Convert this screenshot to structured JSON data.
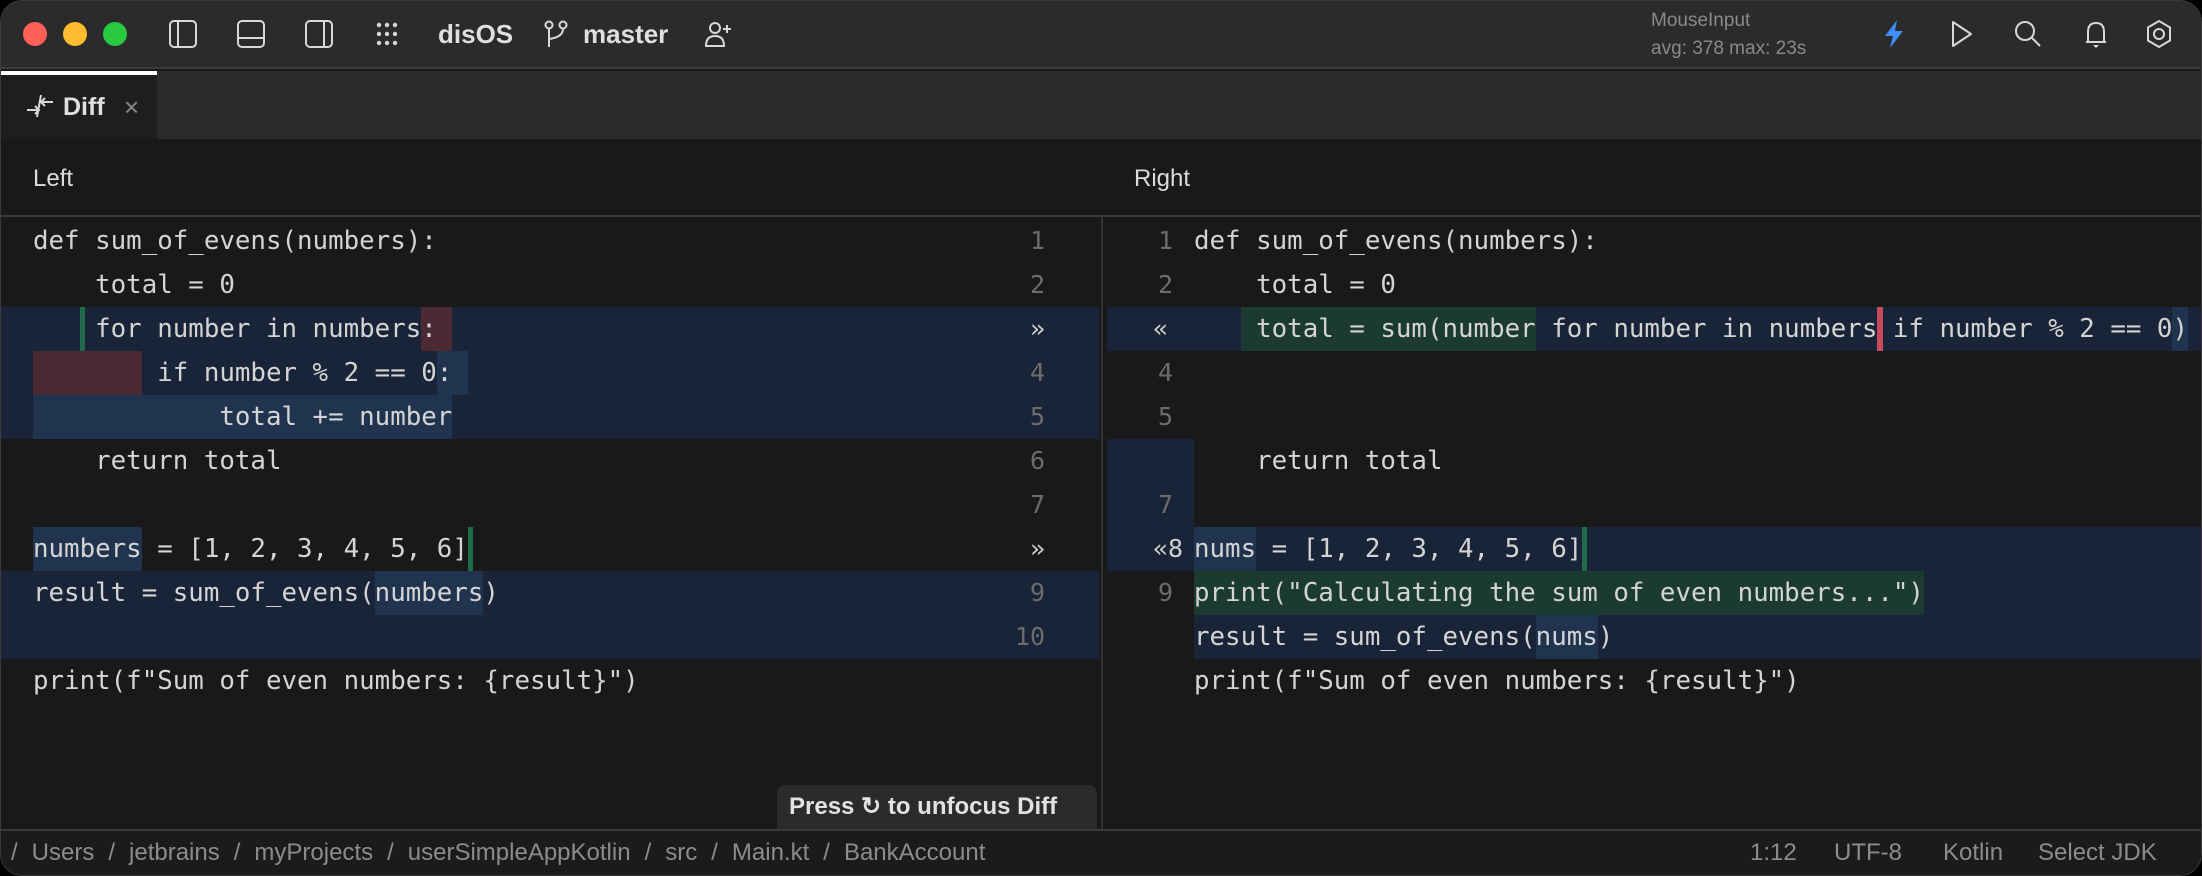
{
  "titlebar": {
    "project": "disOS",
    "branch": "master",
    "perf_title": "MouseInput",
    "perf_stats": "avg: 378 max: 23s",
    "icons": [
      "toggle-left-panel-icon",
      "toggle-bottom-panel-icon",
      "toggle-right-panel-icon",
      "apps-grid-icon",
      "branch-icon",
      "add-user-icon",
      "lightning-icon",
      "run-icon",
      "search-icon",
      "bell-icon",
      "settings-icon"
    ],
    "colors": {
      "accent": "#3d8ef8",
      "close": "#fe5f57",
      "minimize": "#febc2e",
      "maximize": "#28c840"
    }
  },
  "tab": {
    "label": "Diff",
    "close": "×"
  },
  "headers": {
    "left": "Left",
    "right": "Right"
  },
  "left": {
    "lines": [
      "def sum_of_evens(numbers):",
      "    total = 0",
      "    for number in numbers:",
      "        if number % 2 == 0:",
      "            total += number",
      "    return total",
      "",
      "numbers = [1, 2, 3, 4, 5, 6]",
      "result = sum_of_evens(numbers)",
      "",
      "print(f\"Sum of even numbers: {result}\")"
    ],
    "gutter": [
      "1",
      "2",
      "»",
      "4",
      "5",
      "6",
      "7",
      "»",
      "9",
      "10",
      ""
    ]
  },
  "right": {
    "lines": [
      "def sum_of_evens(numbers):",
      "    total = 0",
      "    total = sum(number for number in numbers if number % 2 == 0)",
      "",
      "",
      "    return total",
      "",
      "nums = [1, 2, 3, 4, 5, 6]",
      "print(\"Calculating the sum of even numbers...\")",
      "result = sum_of_evens(nums)",
      "print(f\"Sum of even numbers: {result}\")"
    ],
    "gutter": [
      "1",
      "2",
      "«",
      "4",
      "5",
      "",
      "7",
      "«8",
      "9",
      "",
      ""
    ]
  },
  "tooltip": "Press ↻ to unfocus Diff",
  "status": {
    "breadcrumb": [
      "/",
      "Users",
      "/",
      "jetbrains",
      "/",
      "myProjects",
      "/",
      "userSimpleAppKotlin",
      "/",
      "src",
      "/",
      "Main.kt",
      "/",
      "BankAccount"
    ],
    "position": "1:12",
    "encoding": "UTF-8",
    "language": "Kotlin",
    "jdk": "Select JDK"
  }
}
